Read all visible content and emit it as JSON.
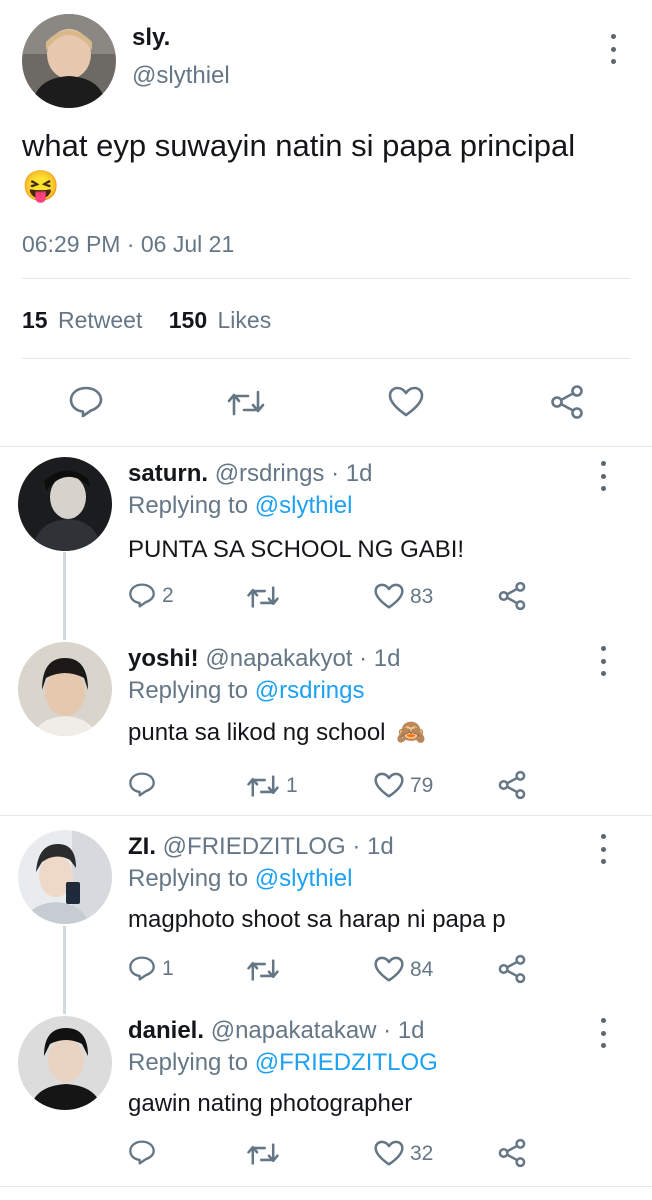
{
  "main_tweet": {
    "display_name": "sly.",
    "handle": "@slythiel",
    "text": "what eyp suwayin natin si papa principal",
    "emoji": "😝",
    "timestamp": "06:29 PM · 06 Jul 21",
    "retweet_count": "15",
    "retweet_label": "Retweet",
    "likes_count": "150",
    "likes_label": "Likes"
  },
  "replies": [
    {
      "display_name": "saturn.",
      "meta": "@rsdrings · 1d",
      "replying_label": "Replying to",
      "replying_to": "@slythiel",
      "text": "PUNTA SA SCHOOL NG GABI!",
      "reply_count": "2",
      "retweet_count": "",
      "like_count": "83"
    },
    {
      "display_name": "yoshi!",
      "meta": "@napakakyot · 1d",
      "replying_label": "Replying to",
      "replying_to": "@rsdrings",
      "text": "punta sa likod ng school",
      "emoji": "🙈",
      "reply_count": "",
      "retweet_count": "1",
      "like_count": "79"
    },
    {
      "display_name": "ZI.",
      "meta": "@FRIEDZITLOG · 1d",
      "replying_label": "Replying to",
      "replying_to": "@slythiel",
      "text": "magphoto shoot sa harap ni papa p",
      "reply_count": "1",
      "retweet_count": "",
      "like_count": "84"
    },
    {
      "display_name": "daniel.",
      "meta": "@napakatakaw · 1d",
      "replying_label": "Replying to",
      "replying_to": "@FRIEDZITLOG",
      "text": "gawin nating photographer",
      "reply_count": "",
      "retweet_count": "",
      "like_count": "32"
    }
  ],
  "icons": {
    "reply": "reply-bubble-icon",
    "retweet": "retweet-arrows-icon",
    "like": "heart-icon",
    "share": "share-nodes-icon",
    "more": "kebab-more-icon"
  },
  "colors": {
    "link": "#1da1f2",
    "muted": "#657786",
    "text": "#14171a",
    "divider": "#e1e8ed"
  }
}
